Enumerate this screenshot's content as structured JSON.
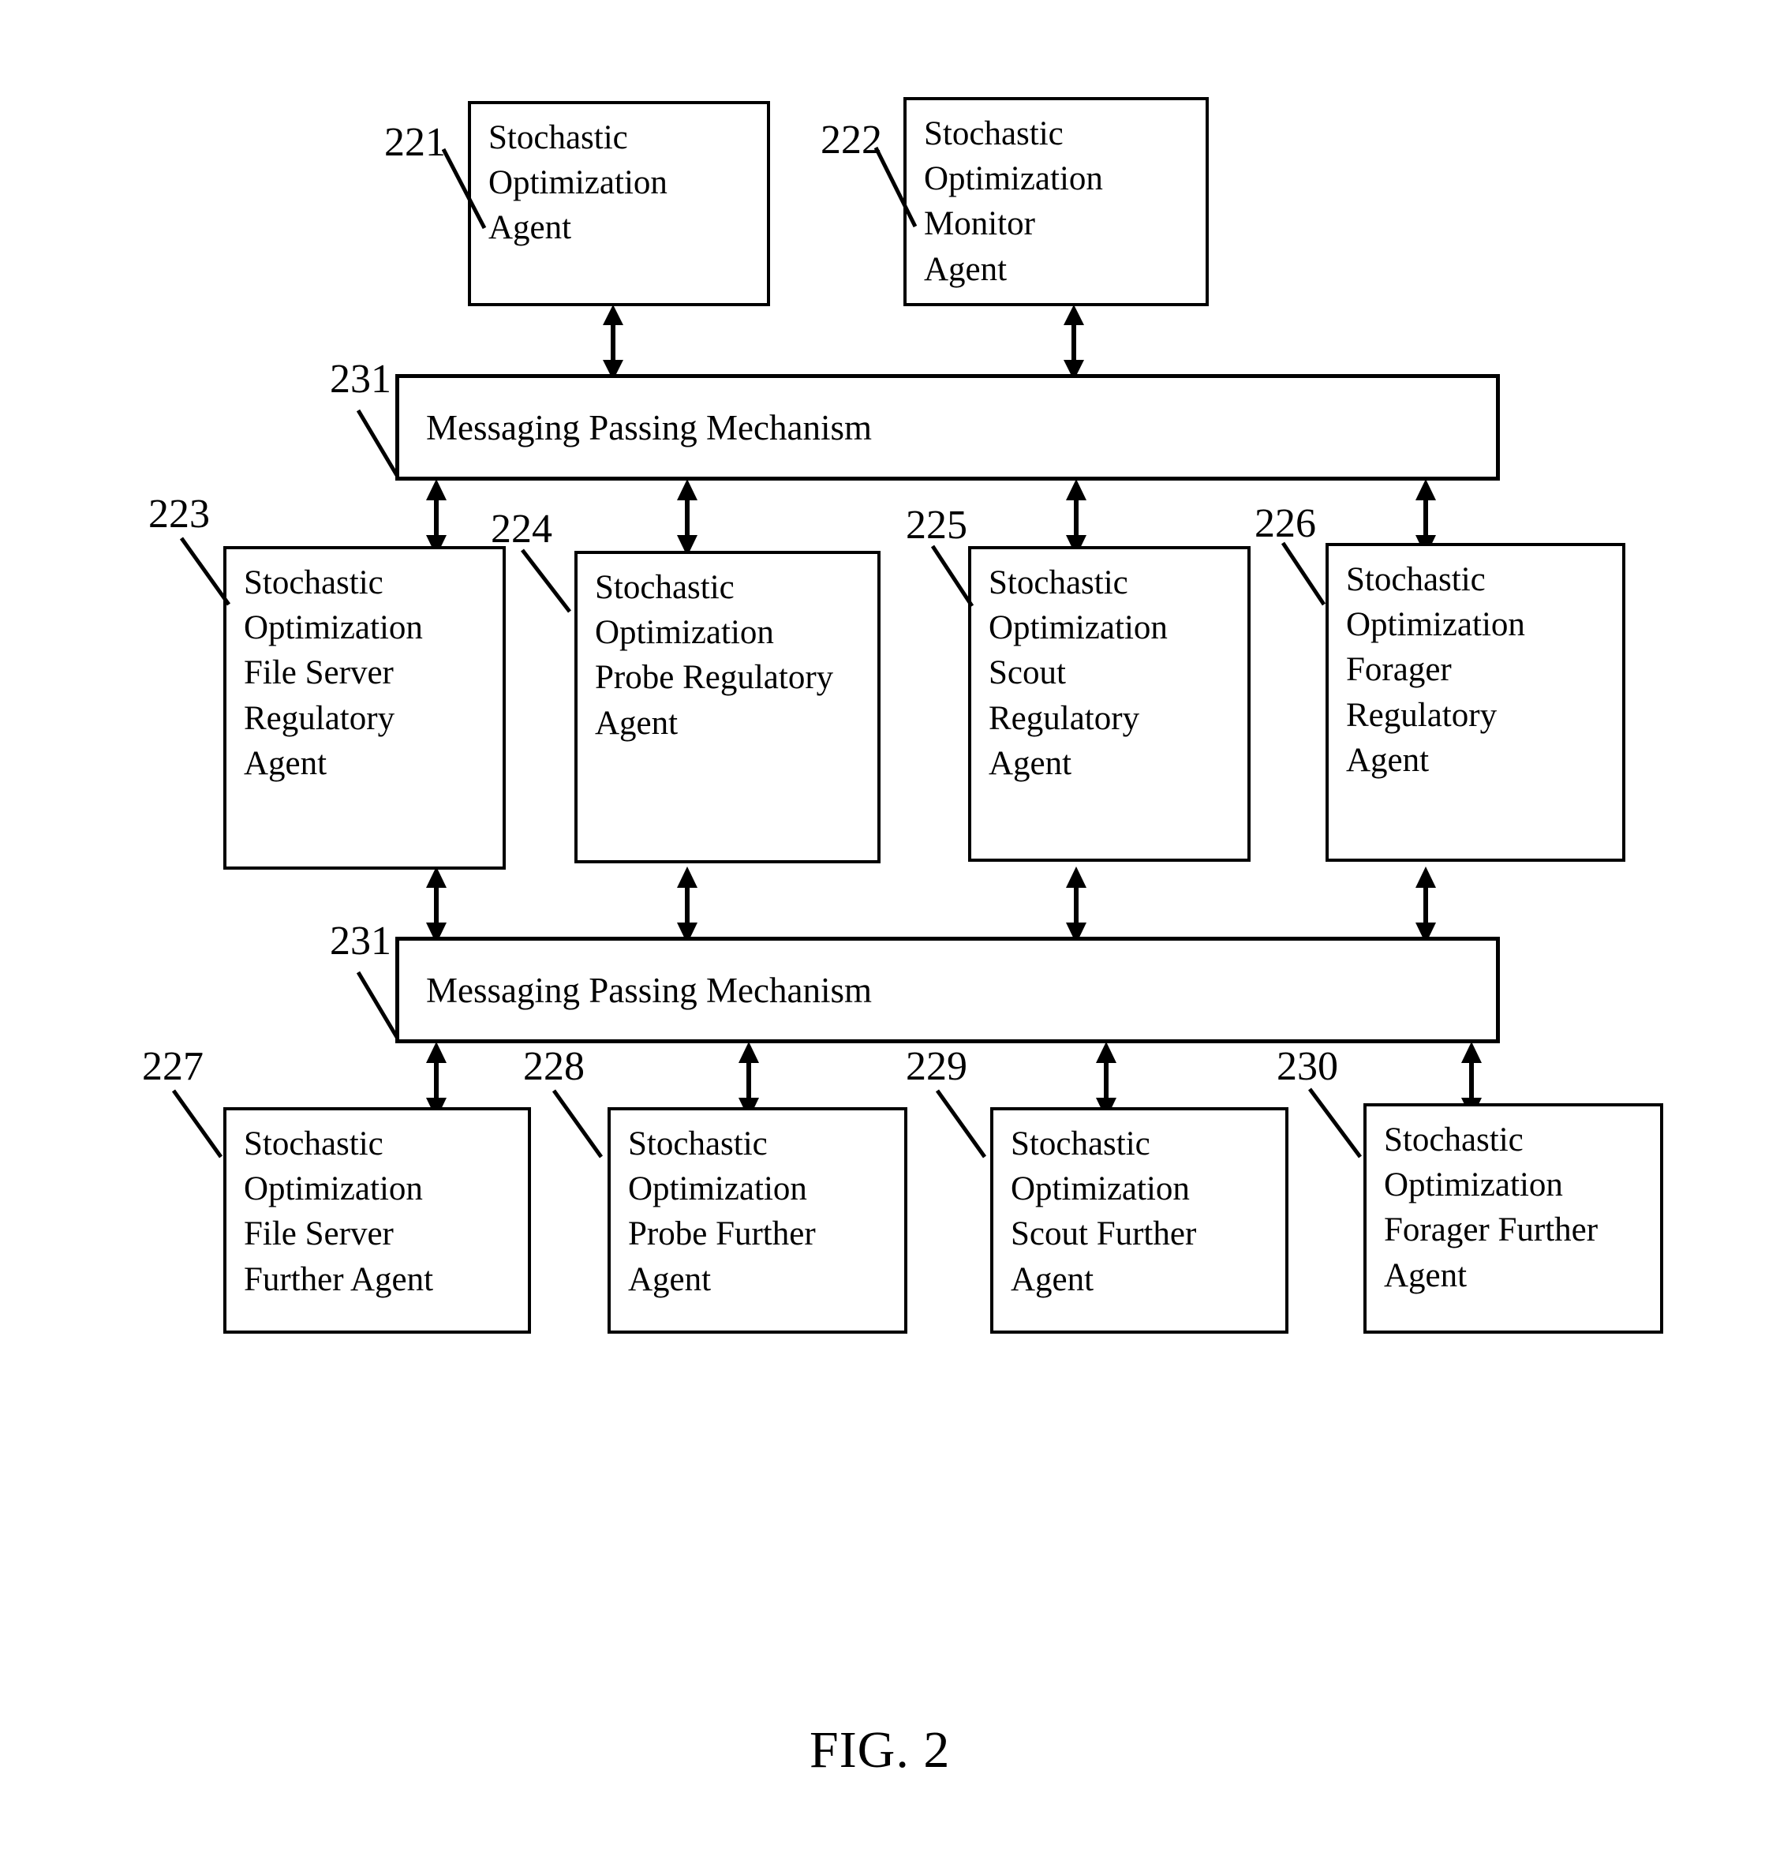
{
  "figure": {
    "caption": "FIG. 2"
  },
  "boxes": [
    {
      "ref": "221",
      "text": "Stochastic\nOptimization\nAgent"
    },
    {
      "ref": "222",
      "text": "Stochastic\nOptimization\nMonitor\nAgent"
    },
    {
      "ref": "223",
      "text": "Stochastic\nOptimization\nFile Server\nRegulatory\nAgent"
    },
    {
      "ref": "224",
      "text": "Stochastic\nOptimization\nProbe Regulatory\nAgent"
    },
    {
      "ref": "225",
      "text": "Stochastic\nOptimization\nScout\nRegulatory\nAgent"
    },
    {
      "ref": "226",
      "text": "Stochastic\nOptimization\nForager\nRegulatory\nAgent"
    },
    {
      "ref": "227",
      "text": "Stochastic\nOptimization\nFile Server\nFurther Agent"
    },
    {
      "ref": "228",
      "text": "Stochastic\nOptimization\nProbe Further\nAgent"
    },
    {
      "ref": "229",
      "text": "Stochastic\nOptimization\nScout  Further\nAgent"
    },
    {
      "ref": "230",
      "text": "Stochastic\nOptimization\nForager Further\nAgent"
    }
  ],
  "bars": [
    {
      "ref": "231",
      "label": "Messaging Passing Mechanism"
    },
    {
      "ref": "231",
      "label": "Messaging Passing Mechanism"
    }
  ],
  "colors": {
    "ink": "#000000",
    "paper": "#ffffff"
  }
}
